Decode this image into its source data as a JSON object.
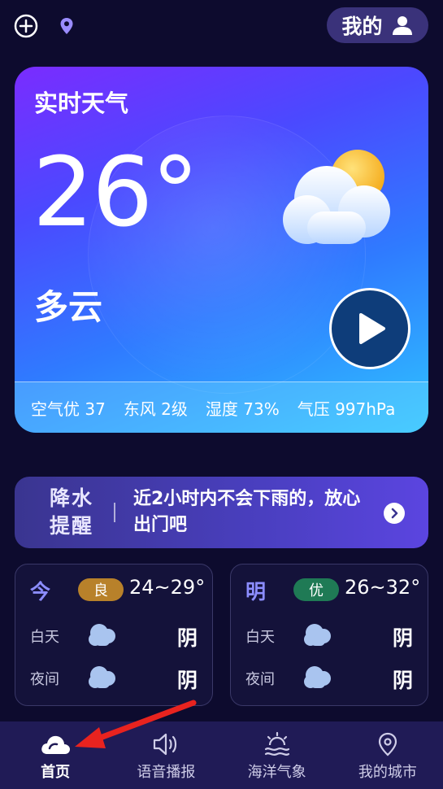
{
  "header": {
    "add_icon": "plus-circle-icon",
    "location_icon": "location-pin-icon",
    "mine_label": "我的",
    "user_icon": "user-icon"
  },
  "weather": {
    "title": "实时天气",
    "temperature": "26°",
    "condition": "多云",
    "icon": "partly-cloudy-icon",
    "stats": {
      "air": "空气优 37",
      "wind": "东风 2级",
      "humidity": "湿度 73%",
      "pressure": "气压 997hPa"
    }
  },
  "rain": {
    "tag_line1": "降水",
    "tag_line2": "提醒",
    "message": "近2小时内不会下雨的，放心出门吧"
  },
  "forecast": [
    {
      "day": "今",
      "aqi": "良",
      "aqi_color": "#b8812a",
      "range": "24~29°",
      "day_label": "白天",
      "day_value": "阴",
      "night_label": "夜间",
      "night_value": "阴"
    },
    {
      "day": "明",
      "aqi": "优",
      "aqi_color": "#1f7a55",
      "range": "26~32°",
      "day_label": "白天",
      "day_value": "阴",
      "night_label": "夜间",
      "night_value": "阴"
    }
  ],
  "nav": [
    {
      "label": "首页",
      "icon": "cloud-icon",
      "active": true
    },
    {
      "label": "语音播报",
      "icon": "speaker-icon",
      "active": false
    },
    {
      "label": "海洋气象",
      "icon": "ocean-sun-icon",
      "active": false
    },
    {
      "label": "我的城市",
      "icon": "location-pin-icon",
      "active": false
    }
  ],
  "colors": {
    "background": "#0d0b2e",
    "nav": "#201b56",
    "annotation_arrow": "#e8231f"
  }
}
